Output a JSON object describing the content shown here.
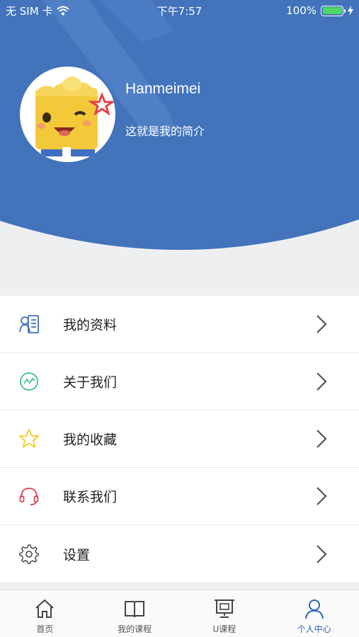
{
  "status_bar": {
    "carrier": "无 SIM 卡",
    "time": "下午7:57",
    "battery_text": "100%",
    "battery_level": 1.0,
    "battery_color": "#4cd964"
  },
  "header": {
    "bg_color": "#4273bb",
    "avatar_icon": "toast-character-avatar",
    "name": "Hanmeimei",
    "bio": "这就是我的简介"
  },
  "menu": {
    "items": [
      {
        "label": "我的资料",
        "icon": "profile-card-icon",
        "icon_color": "#4273bb"
      },
      {
        "label": "关于我们",
        "icon": "pulse-circle-icon",
        "icon_color": "#3dbf9c"
      },
      {
        "label": "我的收藏",
        "icon": "star-icon",
        "icon_color": "#f2cc1f"
      },
      {
        "label": "联系我们",
        "icon": "headset-icon",
        "icon_color": "#e0424d"
      },
      {
        "label": "设置",
        "icon": "gear-icon",
        "icon_color": "#555555"
      }
    ]
  },
  "tabs": [
    {
      "label": "首页",
      "icon": "home-icon",
      "active": false
    },
    {
      "label": "我的课程",
      "icon": "book-icon",
      "active": false
    },
    {
      "label": "U课程",
      "icon": "presentation-board-icon",
      "active": false
    },
    {
      "label": "个人中心",
      "icon": "person-icon",
      "active": true
    }
  ],
  "accent_color": "#2f63b8"
}
